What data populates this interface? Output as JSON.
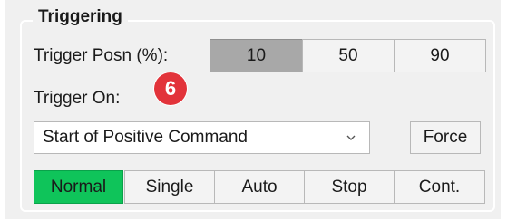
{
  "triggering": {
    "title": "Triggering",
    "trigger_posn_label": "Trigger Posn (%):",
    "posn_buttons": [
      {
        "label": "10",
        "selected": true
      },
      {
        "label": "50",
        "selected": false
      },
      {
        "label": "90",
        "selected": false
      }
    ],
    "trigger_on_label": "Trigger On:",
    "annotation_badge": "6",
    "trigger_on_select": {
      "value": "Start of Positive Command",
      "icon": "chevron-down-icon"
    },
    "force_label": "Force",
    "mode_buttons": [
      {
        "label": "Normal",
        "selected": true
      },
      {
        "label": "Single",
        "selected": false
      },
      {
        "label": "Auto",
        "selected": false
      },
      {
        "label": "Stop",
        "selected": false
      },
      {
        "label": "Cont.",
        "selected": false
      }
    ]
  },
  "colors": {
    "panel_background": "#f0f0f0",
    "selected_mode": "#0fc45a",
    "selected_posn": "#a8a8a8",
    "badge": "#e2333a"
  }
}
